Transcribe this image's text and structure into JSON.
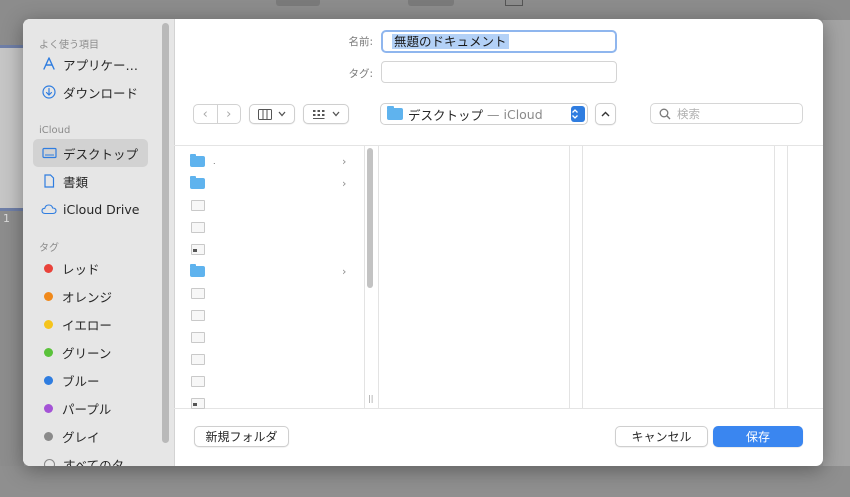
{
  "sidebar": {
    "favorites_header": "よく使う項目",
    "favorites": [
      {
        "label": "アプリケー…",
        "icon": "applications-icon"
      },
      {
        "label": "ダウンロード",
        "icon": "downloads-icon"
      }
    ],
    "icloud_header": "iCloud",
    "icloud": [
      {
        "label": "デスクトップ",
        "icon": "desktop-icon",
        "selected": true
      },
      {
        "label": "書類",
        "icon": "document-icon"
      },
      {
        "label": "iCloud Drive",
        "icon": "cloud-icon"
      }
    ],
    "tags_header": "タグ",
    "tags": [
      {
        "label": "レッド",
        "color": "#e9423a"
      },
      {
        "label": "オレンジ",
        "color": "#f0891b"
      },
      {
        "label": "イエロー",
        "color": "#f5c41c"
      },
      {
        "label": "グリーン",
        "color": "#5ac23a"
      },
      {
        "label": "ブルー",
        "color": "#2f7de0"
      },
      {
        "label": "パープル",
        "color": "#a453d6"
      },
      {
        "label": "グレイ",
        "color": "#8a8a8a"
      },
      {
        "label": "すべてのタ…"
      }
    ]
  },
  "form": {
    "name_label": "名前:",
    "name_value": "無題のドキュメント",
    "tags_label": "タグ:"
  },
  "toolbar": {
    "back": "‹",
    "forward": "›",
    "location": "デスクトップ",
    "location_sub": "— iCloud",
    "search_placeholder": "検索"
  },
  "browser": {
    "rows": [
      {
        "type": "folder",
        "name": ".",
        "has_children": true
      },
      {
        "type": "folder",
        "name": "",
        "has_children": true
      },
      {
        "type": "doc",
        "name": ""
      },
      {
        "type": "doc",
        "name": ""
      },
      {
        "type": "doc2",
        "name": ""
      },
      {
        "type": "folder",
        "name": "",
        "has_children": true
      },
      {
        "type": "doc",
        "name": ""
      },
      {
        "type": "doc",
        "name": ""
      },
      {
        "type": "doc",
        "name": ""
      },
      {
        "type": "doc",
        "name": ""
      },
      {
        "type": "doc",
        "name": ""
      },
      {
        "type": "doc2",
        "name": ""
      }
    ]
  },
  "buttons": {
    "new_folder": "新規フォルダ",
    "cancel": "キャンセル",
    "save": "保存"
  }
}
